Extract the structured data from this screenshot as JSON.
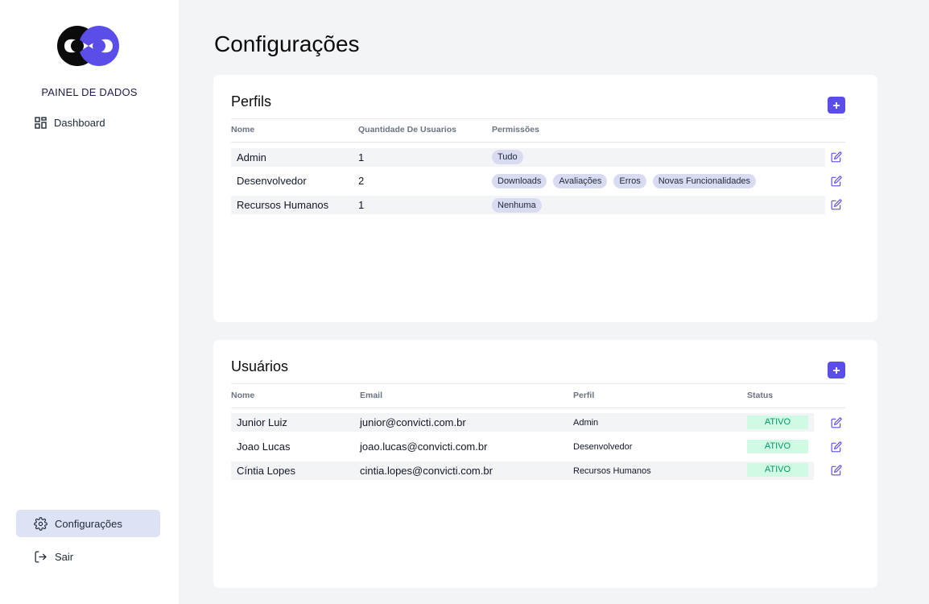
{
  "sidebar": {
    "brand": "PAINEL DE DADOS",
    "items": [
      {
        "label": "Dashboard",
        "icon": "grid-icon"
      },
      {
        "label": "Configurações",
        "icon": "gear-icon",
        "active": true
      },
      {
        "label": "Sair",
        "icon": "logout-icon"
      }
    ]
  },
  "page": {
    "title": "Configurações"
  },
  "colors": {
    "accent": "#5b4de8",
    "active_bg": "#dde3f4",
    "status_bg": "#d1fae5",
    "status_text": "#059669",
    "pill_bg": "#d9dbf3"
  },
  "profiles": {
    "title": "Perfils",
    "columns": [
      "Nome",
      "Quantidade De Usuarios",
      "Permissões"
    ],
    "rows": [
      {
        "name": "Admin",
        "count": "1",
        "permissions": [
          "Tudo"
        ]
      },
      {
        "name": "Desenvolvedor",
        "count": "2",
        "permissions": [
          "Downloads",
          "Avaliações",
          "Erros",
          "Novas Funcionalidades"
        ]
      },
      {
        "name": "Recursos Humanos",
        "count": "1",
        "permissions": [
          "Nenhuma"
        ]
      }
    ]
  },
  "users": {
    "title": "Usuários",
    "columns": [
      "Nome",
      "Email",
      "Perfil",
      "Status"
    ],
    "rows": [
      {
        "name": "Junior Luiz",
        "email": "junior@convicti.com.br",
        "profile": "Admin",
        "status": "ATIVO"
      },
      {
        "name": "Joao Lucas",
        "email": "joao.lucas@convicti.com.br",
        "profile": "Desenvolvedor",
        "status": "ATIVO"
      },
      {
        "name": "Cíntia Lopes",
        "email": "cintia.lopes@convicti.com.br",
        "profile": "Recursos Humanos",
        "status": "ATIVO"
      }
    ]
  }
}
